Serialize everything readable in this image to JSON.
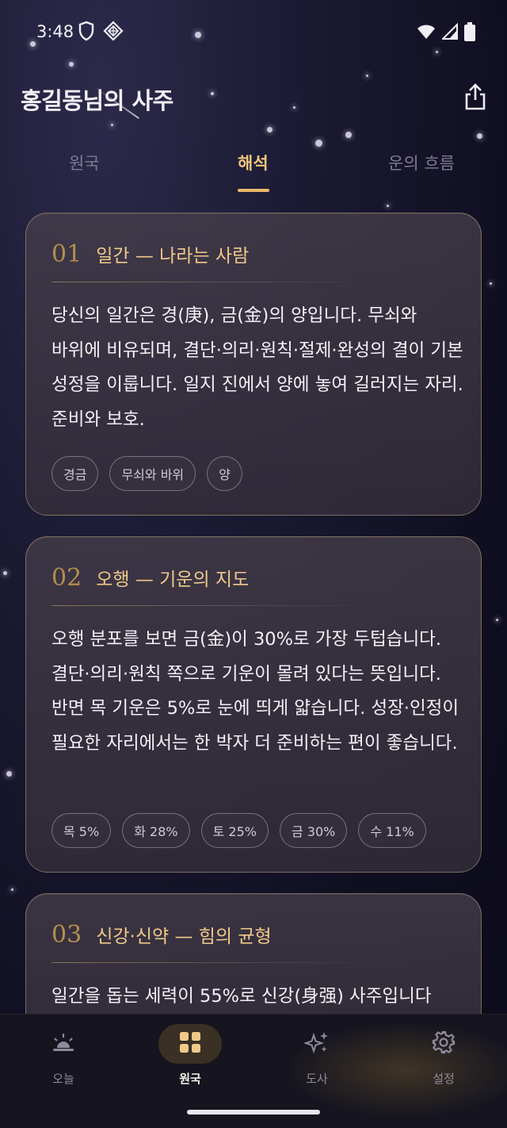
{
  "status_bar": {
    "time": "3:48",
    "icons": [
      "shield-icon",
      "diamond-grid-icon",
      "wifi-icon",
      "signal-icon",
      "battery-icon"
    ]
  },
  "header": {
    "title": "홍길동님의 사주",
    "share_icon": "share-icon"
  },
  "tabs": [
    {
      "label": "원국",
      "active": false
    },
    {
      "label": "해석",
      "active": true
    },
    {
      "label": "운의 흐름",
      "active": false
    }
  ],
  "cards": [
    {
      "number": "01",
      "title": "일간 — 나라는 사람",
      "body": "당신의 일간은 경(庚), 금(金)의 양입니다. 무쇠와 바위에 비유되며, 결단·의리·원칙·절제·완성의 결이 기본 성정을 이룹니다. 일지 진에서 양에 놓여 길러지는 자리. 준비와 보호.",
      "chips": [
        "경금",
        "무쇠와 바위",
        "양"
      ]
    },
    {
      "number": "02",
      "title": "오행 — 기운의 지도",
      "body": "오행 분포를 보면 금(金)이 30%로 가장 두텁습니다. 결단·의리·원칙 쪽으로 기운이 몰려 있다는 뜻입니다. 반면 목 기운은 5%로 눈에 띄게 얇습니다. 성장·인정이 필요한 자리에서는 한 박자 더 준비하는 편이 좋습니다.",
      "chips": [
        "목 5%",
        "화 28%",
        "토 25%",
        "금 30%",
        "수 11%"
      ]
    },
    {
      "number": "03",
      "title": "신강·신약 — 힘의 균형",
      "body": "일간을 돕는 세력이 55%로 신강(身强) 사주입니다"
    }
  ],
  "bottom_nav": [
    {
      "label": "오늘",
      "icon": "sunrise-icon",
      "active": false
    },
    {
      "label": "원국",
      "icon": "grid-icon",
      "active": true
    },
    {
      "label": "도사",
      "icon": "sparkles-icon",
      "active": false
    },
    {
      "label": "설정",
      "icon": "gear-icon",
      "active": false
    }
  ],
  "colors": {
    "accent": "#f1c77b",
    "number": "#b58d4e",
    "background": "#100f22",
    "card": "#3f3845"
  }
}
